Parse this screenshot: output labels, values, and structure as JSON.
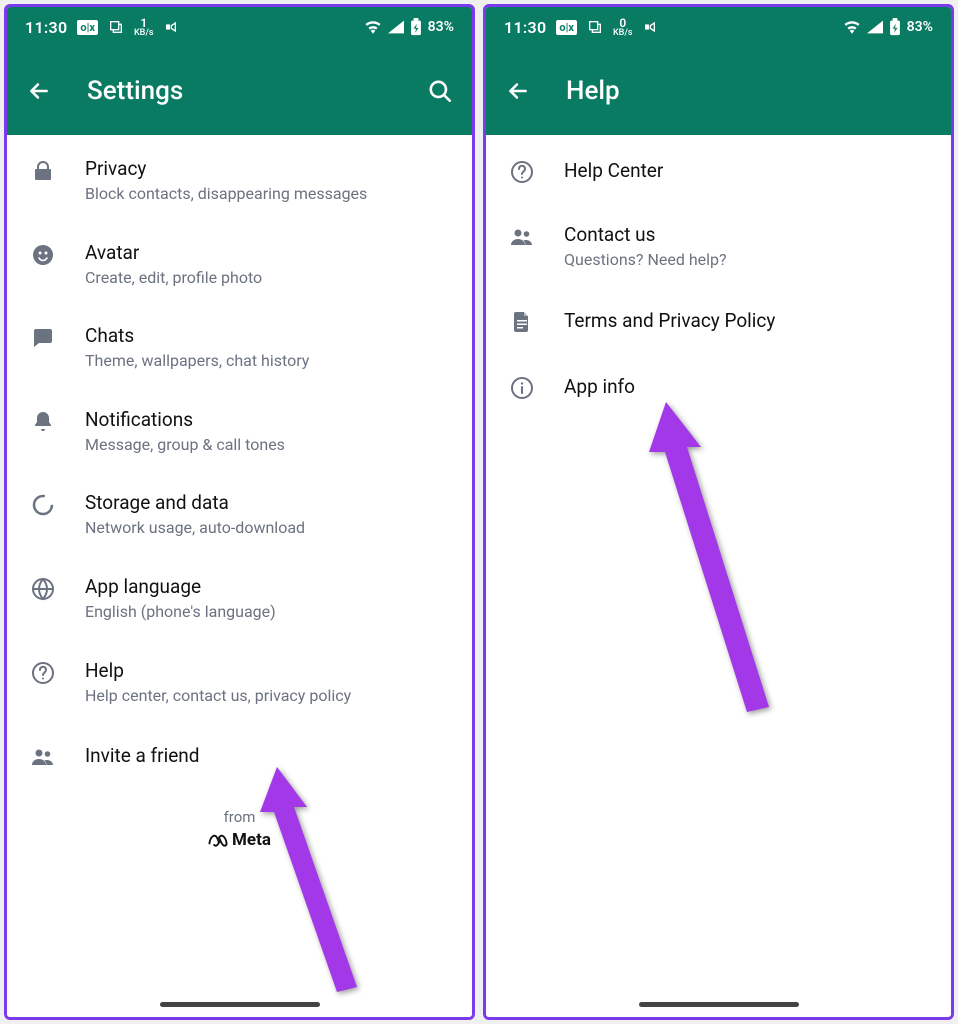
{
  "status": {
    "time": "11:30",
    "data_rate_value": "1",
    "data_rate_unit": "KB/s",
    "data_rate_value2": "0",
    "battery": "83%"
  },
  "left": {
    "title": "Settings",
    "items": [
      {
        "icon": "lock",
        "title": "Privacy",
        "sub": "Block contacts, disappearing messages"
      },
      {
        "icon": "avatar",
        "title": "Avatar",
        "sub": "Create, edit, profile photo"
      },
      {
        "icon": "chat",
        "title": "Chats",
        "sub": "Theme, wallpapers, chat history"
      },
      {
        "icon": "bell",
        "title": "Notifications",
        "sub": "Message, group & call tones"
      },
      {
        "icon": "storage",
        "title": "Storage and data",
        "sub": "Network usage, auto-download"
      },
      {
        "icon": "globe",
        "title": "App language",
        "sub": "English (phone's language)"
      },
      {
        "icon": "help",
        "title": "Help",
        "sub": "Help center, contact us, privacy policy"
      },
      {
        "icon": "people",
        "title": "Invite a friend",
        "sub": ""
      }
    ],
    "footer_from": "from",
    "footer_brand": "Meta"
  },
  "right": {
    "title": "Help",
    "items": [
      {
        "icon": "help",
        "title": "Help Center",
        "sub": ""
      },
      {
        "icon": "people",
        "title": "Contact us",
        "sub": "Questions? Need help?"
      },
      {
        "icon": "doc",
        "title": "Terms and Privacy Policy",
        "sub": ""
      },
      {
        "icon": "info",
        "title": "App info",
        "sub": ""
      }
    ]
  }
}
